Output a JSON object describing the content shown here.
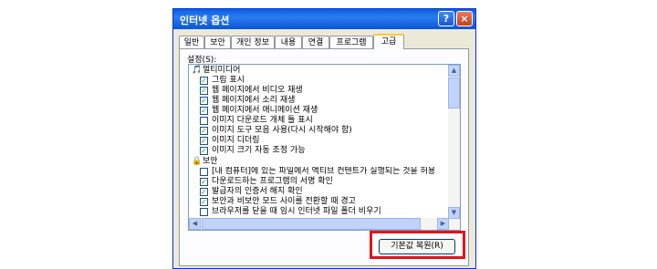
{
  "window": {
    "title": "인터넷 옵션",
    "help_button": "?",
    "close_button": "×"
  },
  "tabs": [
    {
      "label": "일반",
      "active": false
    },
    {
      "label": "보안",
      "active": false
    },
    {
      "label": "개인 정보",
      "active": false
    },
    {
      "label": "내용",
      "active": false
    },
    {
      "label": "연결",
      "active": false
    },
    {
      "label": "프로그램",
      "active": false
    },
    {
      "label": "고급",
      "active": true
    }
  ],
  "settings_label": "설정(S):",
  "settings_list": {
    "groups": [
      {
        "label": "멀티미디어",
        "icon": "multimedia-icon",
        "items": [
          {
            "label": "그림 표시",
            "checked": true
          },
          {
            "label": "웹 페이지에서 비디오 재생",
            "checked": true
          },
          {
            "label": "웹 페이지에서 소리 재생",
            "checked": true
          },
          {
            "label": "웹 페이지에서 애니메이션 재생",
            "checked": true
          },
          {
            "label": "이미지 다운로드 개체 틀 표시",
            "checked": false
          },
          {
            "label": "이미지 도구 모음 사용(다시 시작해야 함)",
            "checked": true
          },
          {
            "label": "이미지 디더링",
            "checked": true
          },
          {
            "label": "이미지 크기 자동 조정 가능",
            "checked": true
          }
        ]
      },
      {
        "label": "보안",
        "icon": "lock-icon",
        "items": [
          {
            "label": "[내 컴퓨터]에 있는 파일에서 액티브 컨텐트가 실행되는 것을 허용",
            "checked": false
          },
          {
            "label": "다운로드하는 프로그램의 서명 확인",
            "checked": true
          },
          {
            "label": "발급자의 인증서 해지 확인",
            "checked": true
          },
          {
            "label": "보안과 비보안 모드 사이를 전환할 때 경고",
            "checked": true
          },
          {
            "label": "브라우저를 닫을 때 임시 인터넷 파일 폴더 비우기",
            "checked": false
          }
        ]
      }
    ]
  },
  "restore_button": "기본값 복원(R)",
  "colors": {
    "title_bar": "#0a5fe0",
    "dialog_bg": "#ece9d8",
    "highlight": "#e0131b",
    "checkmark": "#21a121"
  }
}
